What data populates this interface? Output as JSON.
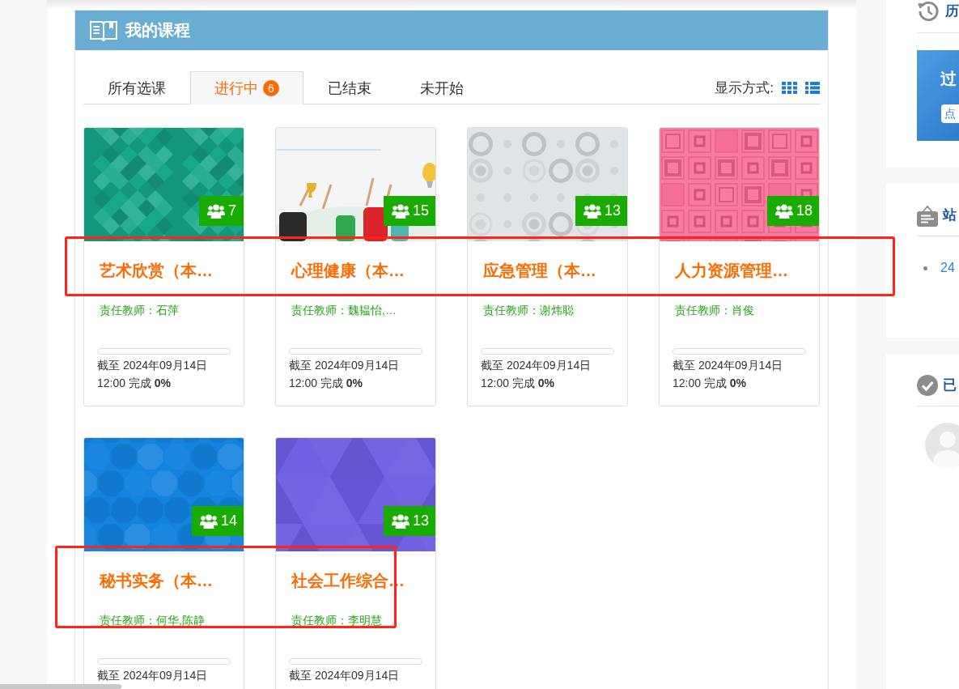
{
  "panel": {
    "title": "我的课程"
  },
  "tabs": [
    {
      "label": "所有选课",
      "selected": false
    },
    {
      "label": "进行中",
      "badge": "6",
      "selected": true
    },
    {
      "label": "已结束",
      "selected": false
    },
    {
      "label": "未开始",
      "selected": false
    }
  ],
  "view_switch": {
    "label": "显示方式:",
    "options": [
      {
        "kind": "grid"
      },
      {
        "kind": "list"
      }
    ]
  },
  "courses": [
    {
      "title": "艺术欣赏（本…",
      "teacher": "责任教师：石萍",
      "students": "7",
      "cover": {
        "kind": "diamonds",
        "color": "#17a88b"
      },
      "level": 0,
      "deadline": "截至 2024年09月14日",
      "completion": "12:00 完成 **0%**"
    },
    {
      "title": "心理健康（本…",
      "teacher": "责任教师：魏韫怡,…",
      "students": "15",
      "cover": {
        "kind": "poster",
        "color": "#f3f5f7"
      },
      "level": 0,
      "deadline": "截至 2024年09月14日",
      "completion": "12:00 完成 **0%**"
    },
    {
      "title": "应急管理（本…",
      "teacher": "责任教师：谢炜聪",
      "students": "13",
      "cover": {
        "kind": "circles",
        "color": "#dfe4e7"
      },
      "level": 0,
      "deadline": "截至 2024年09月14日",
      "completion": "12:00 完成 **0%**"
    },
    {
      "title": "人力资源管理…",
      "teacher": "责任教师：肖俊",
      "students": "18",
      "cover": {
        "kind": "squares",
        "color": "#fa7aa0"
      },
      "level": 0,
      "deadline": "截至 2024年09月14日",
      "completion": "12:00 完成 **0%**"
    },
    {
      "title": "秘书实务（本…",
      "teacher": "责任教师：何华,陈静",
      "students": "14",
      "cover": {
        "kind": "octagons",
        "color": "#1283de"
      },
      "level": 0,
      "deadline": "截至 2024年09月14日"
    },
    {
      "title": "社会工作综合…",
      "teacher": "责任教师：李明慧",
      "students": "13",
      "cover": {
        "kind": "triangles",
        "color": "#6b5ce0"
      },
      "level": 0,
      "deadline": "截至 2024年09月14日"
    }
  ],
  "annotations": [
    {
      "kind": "frame"
    },
    {
      "kind": "frame"
    }
  ],
  "sidebar": {
    "panels": [
      {
        "kind": "banner",
        "title": "历",
        "banner": {
          "title": "过",
          "button": "点"
        }
      },
      {
        "kind": "list",
        "title": "站",
        "items": [
          "24"
        ]
      },
      {
        "kind": "members",
        "title": "已"
      }
    ]
  }
}
